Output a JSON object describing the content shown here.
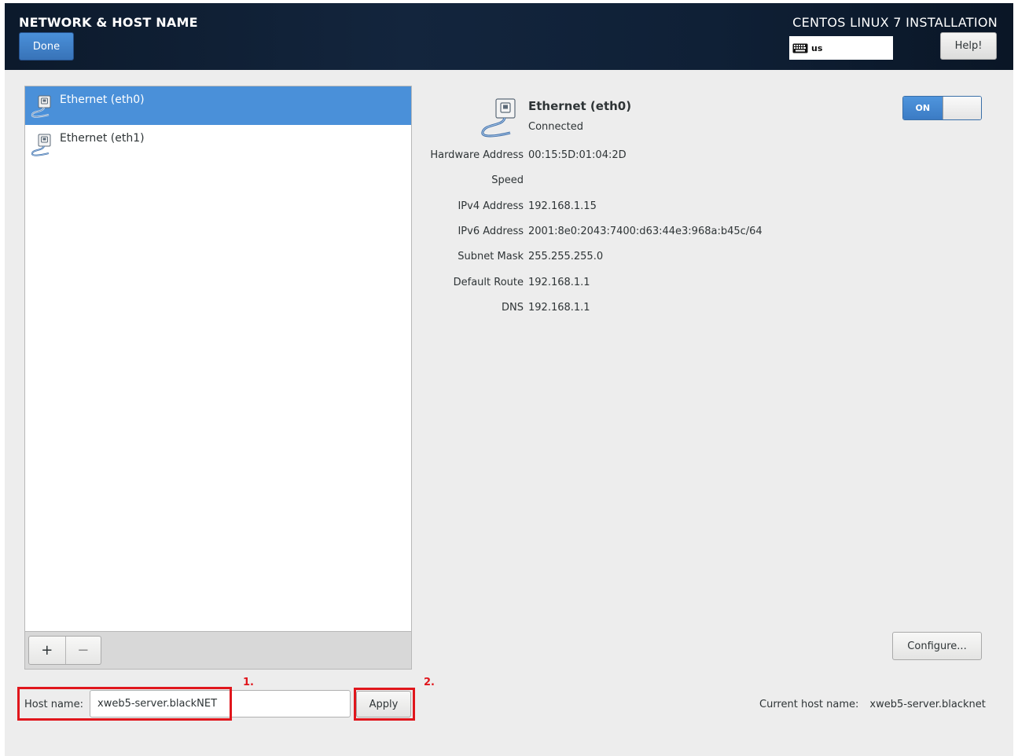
{
  "header": {
    "title": "NETWORK & HOST NAME",
    "done_label": "Done",
    "product": "CENTOS LINUX 7 INSTALLATION",
    "keyboard_layout": "us",
    "help_label": "Help!"
  },
  "devices": [
    {
      "label": "Ethernet (eth0)",
      "selected": true
    },
    {
      "label": "Ethernet (eth1)",
      "selected": false
    }
  ],
  "toolbar": {
    "add_label": "+",
    "remove_label": "−"
  },
  "details": {
    "name": "Ethernet (eth0)",
    "status": "Connected",
    "toggle_label": "ON",
    "properties": [
      {
        "key": "Hardware Address",
        "value": "00:15:5D:01:04:2D"
      },
      {
        "key": "Speed",
        "value": ""
      },
      {
        "key": "IPv4 Address",
        "value": "192.168.1.15"
      },
      {
        "key": "IPv6 Address",
        "value": "2001:8e0:2043:7400:d63:44e3:968a:b45c/64"
      },
      {
        "key": "Subnet Mask",
        "value": "255.255.255.0"
      },
      {
        "key": "Default Route",
        "value": "192.168.1.1"
      },
      {
        "key": "DNS",
        "value": "192.168.1.1"
      }
    ],
    "configure_label": "Configure..."
  },
  "hostname": {
    "label": "Host name:",
    "value": "xweb5-server.blackNET",
    "apply_label": "Apply",
    "current_label": "Current host name:",
    "current_value": "xweb5-server.blacknet"
  },
  "annotations": {
    "step1": "1.",
    "step2": "2."
  },
  "colors": {
    "accent": "#4a90d9",
    "annotation": "#e0161c",
    "header_bg": "#0f2036"
  }
}
